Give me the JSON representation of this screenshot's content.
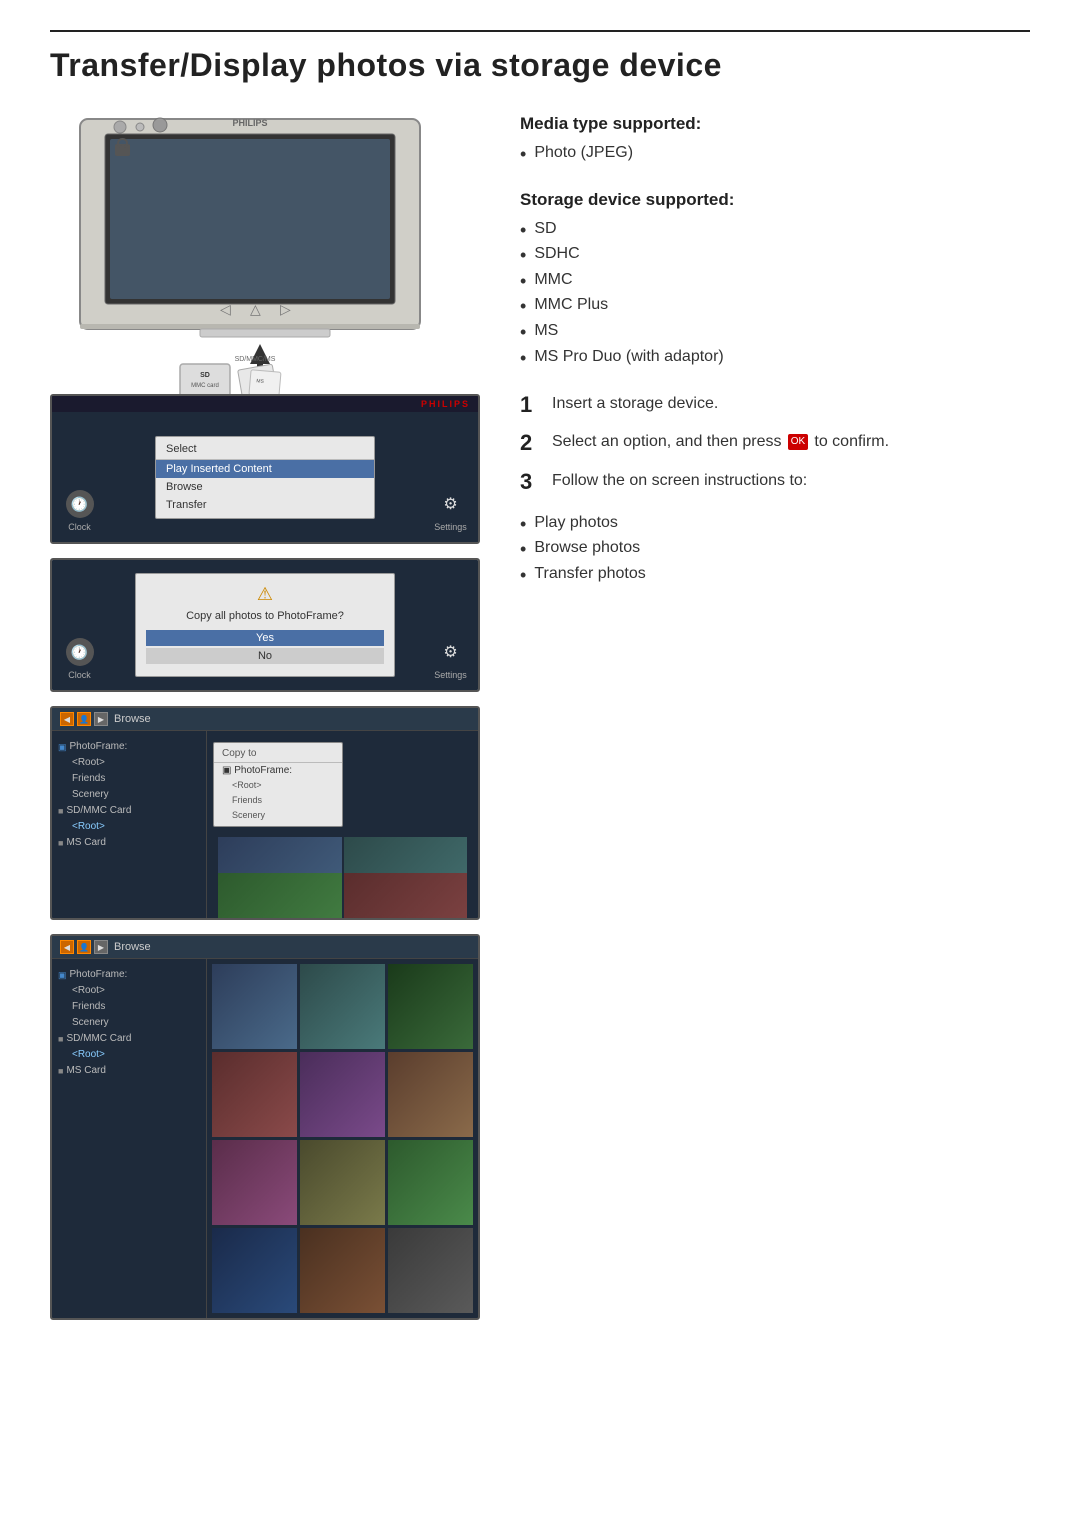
{
  "page": {
    "title": "Transfer/Display photos via storage device"
  },
  "media_section": {
    "heading": "Media type supported:",
    "items": [
      "Photo (JPEG)"
    ]
  },
  "storage_section": {
    "heading": "Storage device supported:",
    "items": [
      "SD",
      "SDHC",
      "MMC",
      "MMC Plus",
      "MS",
      "MS Pro Duo (with adaptor)"
    ]
  },
  "steps": [
    {
      "num": "1",
      "text": "Insert a storage device."
    },
    {
      "num": "2",
      "text": "Select an option, and then press  to confirm."
    },
    {
      "num": "3",
      "text": "Follow the on screen instructions to:"
    }
  ],
  "follow_items": [
    "Play photos",
    "Browse photos",
    "Transfer photos"
  ],
  "panel1": {
    "philips": "PHILIPS",
    "menu_title": "Select",
    "menu_items": [
      "Play Inserted Content",
      "Browse",
      "Transfer"
    ],
    "left_label": "Clock",
    "right_label": "Settings"
  },
  "panel2": {
    "dialog_text": "Copy all photos to PhotoFrame?",
    "btn_yes": "Yes",
    "btn_no": "No",
    "left_label": "Clock",
    "right_label": "Settings"
  },
  "browse_panel1": {
    "header": "Browse",
    "tree": [
      "PhotoFrame:",
      "<Root>",
      "Friends",
      "Scenery",
      "SD/MMC Card",
      "<Root>",
      "MS Card"
    ],
    "copy_menu_title": "Copy to",
    "copy_menu_items": [
      "PhotoFrame:",
      "<Root>",
      "Friends",
      "Scenery"
    ]
  },
  "browse_panel2": {
    "header": "Browse",
    "tree": [
      "PhotoFrame:",
      "<Root>",
      "Friends",
      "Scenery",
      "SD/MMC Card",
      "<Root>",
      "MS Card"
    ],
    "thumbnails": [
      "thumb-blue",
      "thumb-teal",
      "thumb-green",
      "thumb-red",
      "thumb-forest",
      "thumb-purple",
      "thumb-pink",
      "thumb-olive",
      "thumb-orange",
      "thumb-navy",
      "thumb-brown",
      "thumb-gray"
    ]
  }
}
